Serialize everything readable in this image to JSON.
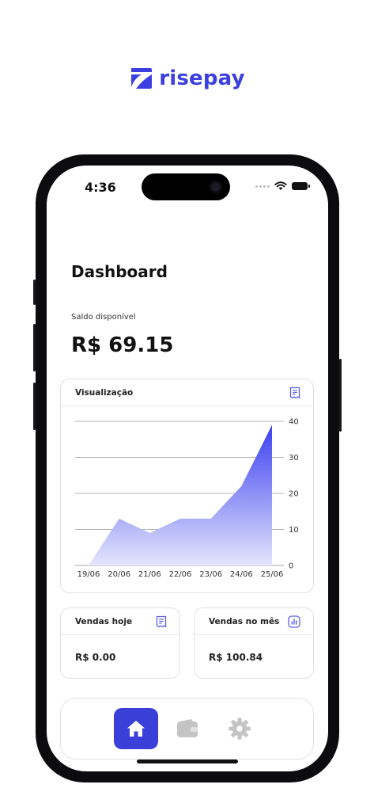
{
  "brand": {
    "name": "risepay"
  },
  "status_bar": {
    "time": "4:36"
  },
  "dashboard": {
    "title": "Dashboard",
    "balance_label": "Saldo disponível",
    "balance_value": "R$ 69.15"
  },
  "chart_card": {
    "title": "Visualização",
    "icon": "receipt-icon"
  },
  "chart_data": {
    "type": "area",
    "x": [
      "19/06",
      "20/06",
      "21/06",
      "22/06",
      "23/06",
      "24/06",
      "25/06"
    ],
    "series": [
      {
        "values": [
          0,
          13,
          9,
          13,
          13,
          22,
          39
        ]
      }
    ],
    "yticks": [
      0,
      10,
      20,
      30,
      40
    ],
    "ylim": [
      0,
      40
    ],
    "y_axis_side": "right",
    "grid": true,
    "colors": {
      "top": "#3b3ff0",
      "bottom": "#e4e6fc"
    }
  },
  "cards": {
    "sales_today": {
      "title": "Vendas hoje",
      "value": "R$ 0.00",
      "icon": "receipt-icon"
    },
    "sales_month": {
      "title": "Vendas no mês",
      "value": "R$ 100.84",
      "icon": "bar-chart-icon"
    }
  },
  "nav": [
    {
      "name": "home",
      "icon": "home-icon",
      "active": true
    },
    {
      "name": "wallet",
      "icon": "wallet-icon",
      "active": false
    },
    {
      "name": "settings",
      "icon": "gear-icon",
      "active": false
    }
  ],
  "colors": {
    "accent": "#3a3fd8",
    "icon_accent": "#5b5fe8",
    "inactive_icon": "#c4c4c4"
  }
}
